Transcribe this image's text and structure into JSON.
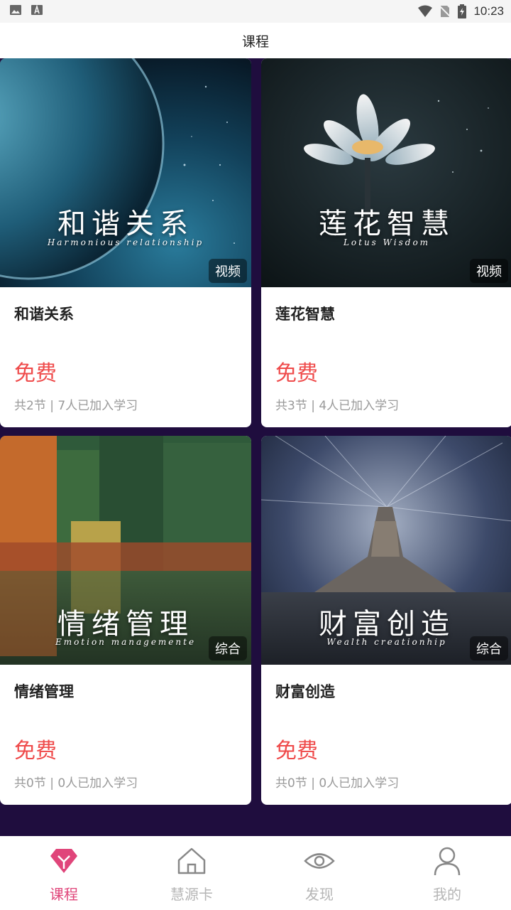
{
  "status_bar": {
    "time": "10:23",
    "icons": [
      "image-icon",
      "font-icon",
      "wifi-icon",
      "no-sim-icon",
      "battery-icon"
    ]
  },
  "app_bar": {
    "title": "课程"
  },
  "courses": [
    {
      "cover_title": "和谐关系",
      "cover_subtitle": "Harmonious relationship",
      "badge": "视频",
      "title": "和谐关系",
      "price": "免费",
      "meta": "共2节 | 7人已加入学习"
    },
    {
      "cover_title": "莲花智慧",
      "cover_subtitle": "Lotus Wisdom",
      "badge": "视频",
      "title": "莲花智慧",
      "price": "免费",
      "meta": "共3节 | 4人已加入学习"
    },
    {
      "cover_title": "情绪管理",
      "cover_subtitle": "Emotion managemente",
      "badge": "综合",
      "title": "情绪管理",
      "price": "免费",
      "meta": "共0节 | 0人已加入学习"
    },
    {
      "cover_title": "财富创造",
      "cover_subtitle": "Wealth creationhip",
      "badge": "综合",
      "title": "财富创造",
      "price": "免费",
      "meta": "共0节 | 0人已加入学习"
    }
  ],
  "nav": [
    {
      "label": "课程",
      "icon": "diamond-icon",
      "active": true
    },
    {
      "label": "慧源卡",
      "icon": "home-icon",
      "active": false
    },
    {
      "label": "发现",
      "icon": "eye-icon",
      "active": false
    },
    {
      "label": "我的",
      "icon": "person-icon",
      "active": false
    }
  ],
  "colors": {
    "accent": "#e0457a",
    "price": "#ef4a4a",
    "background": "#1f0d3e"
  }
}
